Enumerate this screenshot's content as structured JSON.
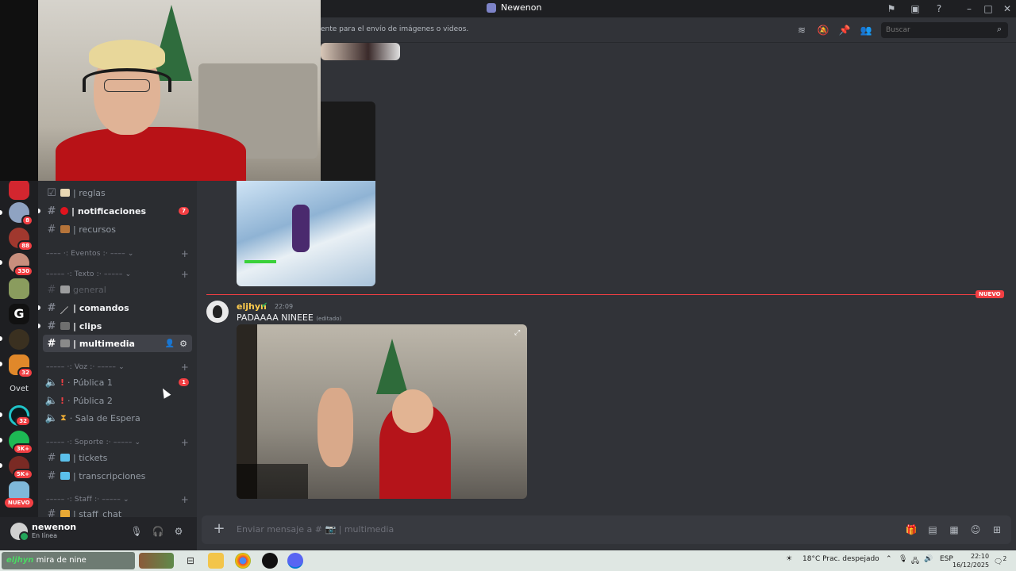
{
  "window": {
    "title": "Newenon"
  },
  "header": {
    "topic": "ente para el envío de imágenes o videos.",
    "search_placeholder": "Buscar"
  },
  "servers": {
    "items": [
      {
        "name": "server-1",
        "badge": ""
      },
      {
        "name": "server-2",
        "badge": "8"
      },
      {
        "name": "server-3",
        "badge": "88"
      },
      {
        "name": "server-4",
        "badge": "330"
      },
      {
        "name": "server-5",
        "badge": ""
      },
      {
        "name": "server-g",
        "badge": ""
      },
      {
        "name": "server-7",
        "badge": ""
      },
      {
        "name": "server-8",
        "badge": "32"
      },
      {
        "name": "server-ovet-text",
        "label": "Ovet"
      },
      {
        "name": "server-10",
        "badge": "32"
      },
      {
        "name": "server-11",
        "badge": "3K+"
      },
      {
        "name": "server-12",
        "badge": "5K+"
      },
      {
        "name": "server-13",
        "badge": ""
      }
    ],
    "nuevo": "NUEVO"
  },
  "channels": {
    "reglas": "| reglas",
    "notificaciones": "| notificaciones",
    "notificaciones_count": "7",
    "recursos": "| recursos",
    "cat_eventos": "–––– ·: Eventos :· ––––",
    "cat_texto": "––––– ·: Texto :· –––––",
    "general": "general",
    "comandos": "| comandos",
    "clips": "| clips",
    "multimedia": "| multimedia",
    "cat_voz": "––––– ·: Voz :· –––––",
    "publica1": "· Pública 1",
    "publica1_count": "1",
    "publica2": "· Pública 2",
    "sala": "· Sala de Espera",
    "cat_soporte": "––––– ·: Soporte :· –––––",
    "tickets": "| tickets",
    "transcripciones": "| transcripciones",
    "cat_staff": "––––– ·: Staff :· –––––",
    "staff_chat": "| staff_chat"
  },
  "user": {
    "name": "newenon",
    "status": "En línea"
  },
  "message": {
    "author": "eljhyn",
    "time": "22:09",
    "text": "PADAAAA NINEEE",
    "edited": "(editado)",
    "new_label": "NUEVO"
  },
  "composer": {
    "placeholder": "Enviar mensaje a # 📷 | multimedia"
  },
  "taskbar": {
    "search_prefix": "eljhyn",
    "search_text": " mira de nine",
    "weather": "18°C  Prac. despejado",
    "lang": "ESP",
    "time": "22:10",
    "date": "16/12/2025",
    "notif": "2"
  }
}
